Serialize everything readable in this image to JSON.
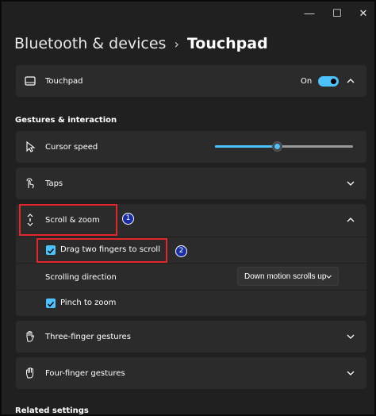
{
  "window": {
    "minimize_glyph": "—",
    "maximize_glyph": "☐",
    "close_glyph": "✕"
  },
  "breadcrumb": {
    "parent": "Bluetooth & devices",
    "separator": "›",
    "current": "Touchpad"
  },
  "touchpad": {
    "label": "Touchpad",
    "icon": "touchpad-icon",
    "toggle_state": "On"
  },
  "section": {
    "title": "Gestures & interaction"
  },
  "cursor_speed": {
    "label": "Cursor speed",
    "icon": "cursor-icon",
    "slider_value": 0.45
  },
  "taps": {
    "label": "Taps",
    "icon": "tap-icon"
  },
  "scroll_zoom": {
    "label": "Scroll & zoom",
    "icon": "scroll-icon",
    "drag_two_fingers": "Drag two fingers to scroll",
    "scrolling_direction_label": "Scrolling direction",
    "scrolling_direction_value": "Down motion scrolls up",
    "pinch_to_zoom": "Pinch to zoom"
  },
  "three_finger": {
    "label": "Three-finger gestures",
    "icon": "hand-icon"
  },
  "four_finger": {
    "label": "Four-finger gestures",
    "icon": "hand-icon"
  },
  "related": {
    "title": "Related settings"
  },
  "annotations": {
    "badge_1": "1",
    "badge_2": "2"
  },
  "colors": {
    "accent": "#4cc2ff",
    "highlight": "#e3262a",
    "badge": "#1a2ea8"
  }
}
